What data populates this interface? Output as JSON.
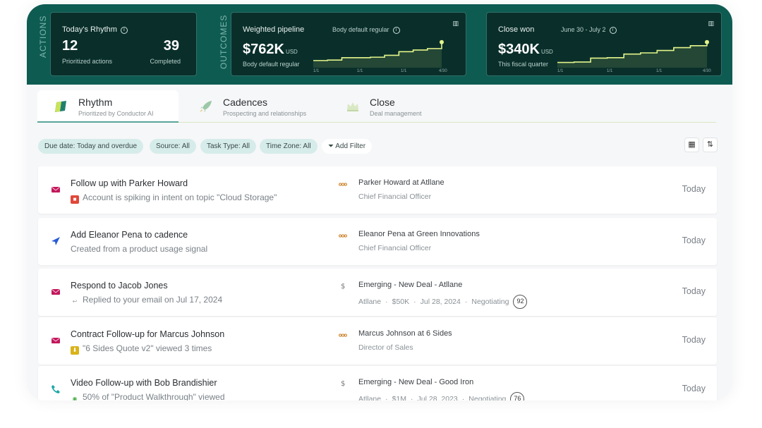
{
  "header": {
    "actions_label": "ACTIONS",
    "outcomes_label": "OUTCOMES",
    "rhythm_card": {
      "title": "Today's Rhythm",
      "prioritized_value": "12",
      "prioritized_label": "Prioritized actions",
      "completed_value": "39",
      "completed_label": "Completed"
    },
    "pipeline_card": {
      "title": "Weighted pipeline",
      "legend_label": "Body default regular",
      "value": "$762K",
      "unit": "USD",
      "sub": "Body default regular",
      "ticks": [
        "1/1",
        "1/1",
        "1/1",
        "4/30"
      ],
      "trend": [
        0.18,
        0.2,
        0.3,
        0.3,
        0.32,
        0.4,
        0.55,
        0.62,
        0.68,
        0.95
      ]
    },
    "closewon_card": {
      "title": "Close won",
      "range": "June 30 - July 2",
      "value": "$340K",
      "unit": "USD",
      "sub": "This fiscal quarter",
      "ticks": [
        "1/1",
        "1/1",
        "1/1",
        "4/30"
      ],
      "trend": [
        0.1,
        0.12,
        0.28,
        0.3,
        0.45,
        0.5,
        0.6,
        0.72,
        0.8,
        0.95
      ]
    },
    "accent": "#0e5b52",
    "line_color": "#e3f58a"
  },
  "tabs": [
    {
      "label": "Rhythm",
      "sub": "Prioritized by Conductor AI"
    },
    {
      "label": "Cadences",
      "sub": "Prospecting and relationships"
    },
    {
      "label": "Close",
      "sub": "Deal management"
    }
  ],
  "filters": {
    "chips": [
      "Due date: Today and overdue",
      "Source: All",
      "Task Type: All",
      "Time Zone: All"
    ],
    "add_filter": "Add Filter"
  },
  "tasks": [
    {
      "icon": "email-icon",
      "title": "Follow up with Parker Howard",
      "sub": "Account is spiking in intent on topic \"Cloud Storage\"",
      "sub_icon": "intent-icon",
      "contact": "Parker Howard  at  Atllane",
      "contact_sub": "Chief Financial Officer",
      "mid_icon": "persona-icon",
      "due": "Today"
    },
    {
      "icon": "cadence-icon",
      "title": "Add Eleanor Pena to cadence",
      "sub": "Created from a product usage signal",
      "sub_icon": "",
      "contact": "Eleanor Pena  at  Green Innovations",
      "contact_sub": "Chief Financial Officer",
      "mid_icon": "persona-icon",
      "due": "Today"
    },
    {
      "icon": "email-icon",
      "title": "Respond to Jacob Jones",
      "sub": "Replied to your email on Jul 17, 2024",
      "sub_icon": "reply-icon",
      "contact": "Emerging - New Deal - Atllane",
      "deal": [
        "Atllane",
        "$50K",
        "Jul 28, 2024",
        "Negotiating"
      ],
      "score": "92",
      "mid_icon": "dollar-icon",
      "due": "Today"
    },
    {
      "icon": "email-icon",
      "title": "Contract Follow-up for Marcus Johnson",
      "sub": "\"6 Sides Quote v2\" viewed 3 times",
      "sub_icon": "download-icon",
      "contact": "Marcus Johnson  at  6 Sides",
      "contact_sub": "Director of Sales",
      "mid_icon": "persona-icon",
      "due": "Today"
    },
    {
      "icon": "phone-icon",
      "title": "Video Follow-up with Bob Brandishier",
      "sub": "50% of \"Product Walkthrough\" viewed",
      "sub_icon": "video-icon",
      "contact": "Emerging - New Deal - Good Iron",
      "deal": [
        "Atllane",
        "$1M",
        "Jul 28, 2023",
        "Negotiating"
      ],
      "score": "76",
      "mid_icon": "dollar-icon",
      "due": "Today"
    }
  ]
}
